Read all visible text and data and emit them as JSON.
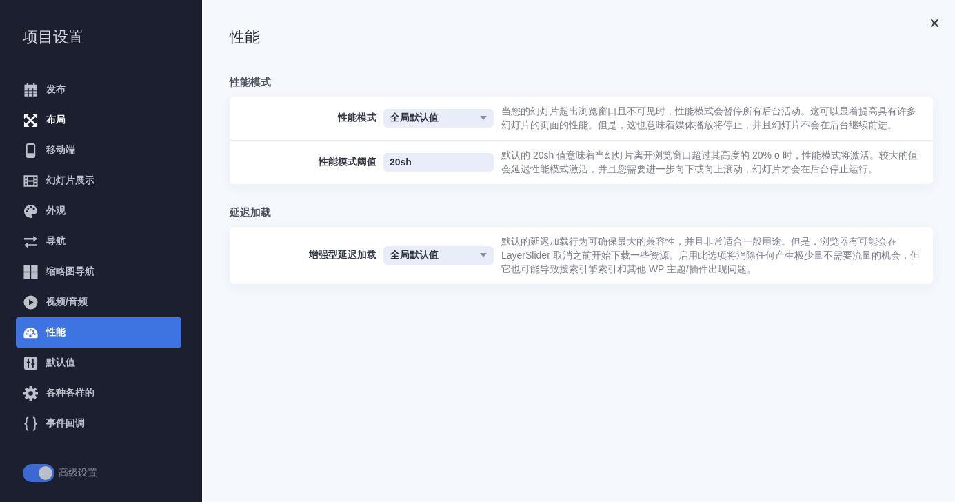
{
  "sidebar": {
    "title": "项目设置",
    "items": [
      {
        "label": "发布",
        "selected": false,
        "hovered": false
      },
      {
        "label": "布局",
        "selected": false,
        "hovered": true
      },
      {
        "label": "移动端",
        "selected": false,
        "hovered": false
      },
      {
        "label": "幻灯片展示",
        "selected": false,
        "hovered": false
      },
      {
        "label": "外观",
        "selected": false,
        "hovered": false
      },
      {
        "label": "导航",
        "selected": false,
        "hovered": false
      },
      {
        "label": "缩略图导航",
        "selected": false,
        "hovered": false
      },
      {
        "label": "视频/音频",
        "selected": false,
        "hovered": false
      },
      {
        "label": "性能",
        "selected": true,
        "hovered": false
      },
      {
        "label": "默认值",
        "selected": false,
        "hovered": false
      },
      {
        "label": "各种各样的",
        "selected": false,
        "hovered": false
      },
      {
        "label": "事件回调",
        "selected": false,
        "hovered": false
      }
    ],
    "advanced_toggle": {
      "label": "高级设置",
      "on": true
    }
  },
  "page": {
    "title": "性能"
  },
  "sections": [
    {
      "heading": "性能模式",
      "rows": [
        {
          "label": "性能模式",
          "kind": "select",
          "value": "全局默认值",
          "description": "当您的幻灯片超出浏览窗口且不可见时，性能模式会暂停所有后台活动。这可以显着提高具有许多幻灯片的页面的性能。但是，这也意味着媒体播放将停止，并且幻灯片不会在后台继续前进。"
        },
        {
          "label": "性能模式阈值",
          "kind": "text",
          "value": "20sh",
          "description": "默认的 20sh 值意味着当幻灯片离开浏览窗口超过其高度的 20% o 时，性能模式将激活。较大的值会延迟性能模式激活，并且您需要进一步向下或向上滚动，幻灯片才会在后台停止运行。"
        }
      ]
    },
    {
      "heading": "延迟加载",
      "rows": [
        {
          "label": "增强型延迟加载",
          "kind": "select",
          "value": "全局默认值",
          "description": "默认的延迟加载行为可确保最大的兼容性，并且非常适合一般用途。但是，浏览器有可能会在 LayerSlider 取消之前开始下载一些资源。启用此选项将消除任何产生极少量不需要流量的机会，但它也可能导致搜索引擎索引和其他 WP 主题/插件出现问题。"
        }
      ]
    }
  ]
}
